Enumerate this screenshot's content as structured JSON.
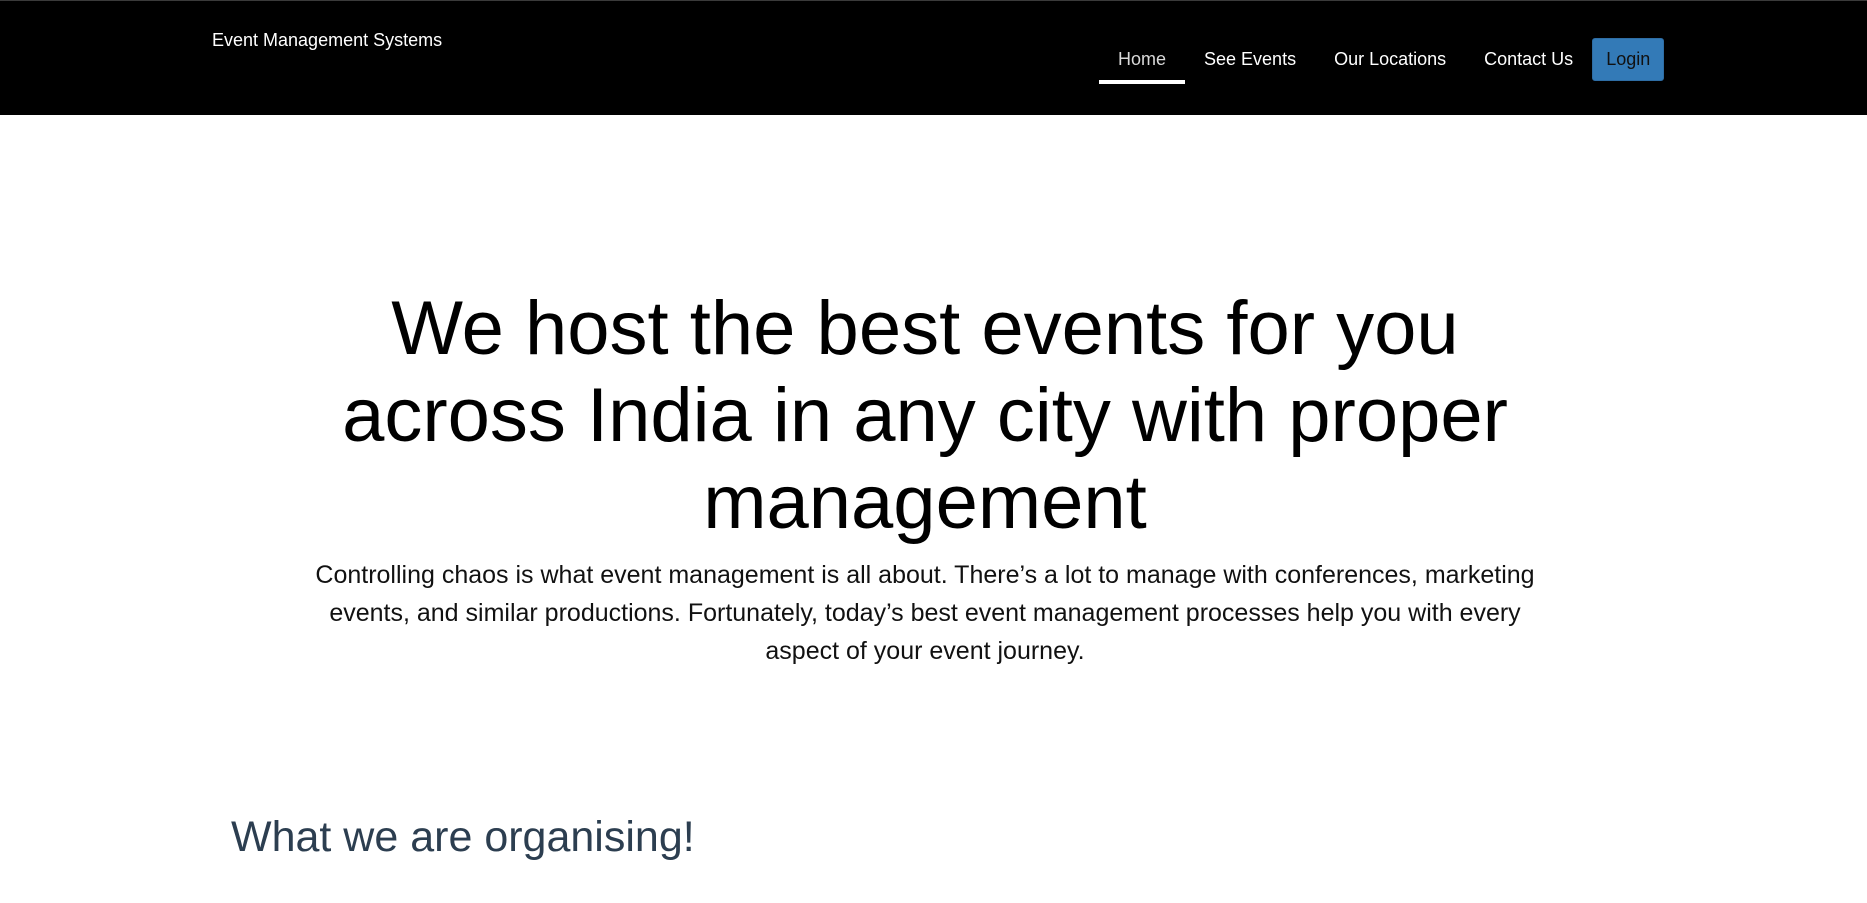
{
  "header": {
    "brand": "Event Management Systems",
    "nav": [
      {
        "label": "Home",
        "active": true
      },
      {
        "label": "See Events",
        "active": false
      },
      {
        "label": "Our Locations",
        "active": false
      },
      {
        "label": "Contact Us",
        "active": false
      }
    ],
    "login_label": "Login"
  },
  "hero": {
    "title": "We host the best events for you across India in any city with proper management",
    "text": "Controlling chaos is what event management is all about. There’s a lot to manage with conferences, marketing events, and similar productions. Fortunately, today’s best event management processes help you with every aspect of your event journey."
  },
  "sections": {
    "organising_title": "What we are organising!"
  },
  "colors": {
    "navbar_bg": "#000000",
    "login_button_bg": "#337ab7",
    "section_title": "#2c3e50"
  }
}
